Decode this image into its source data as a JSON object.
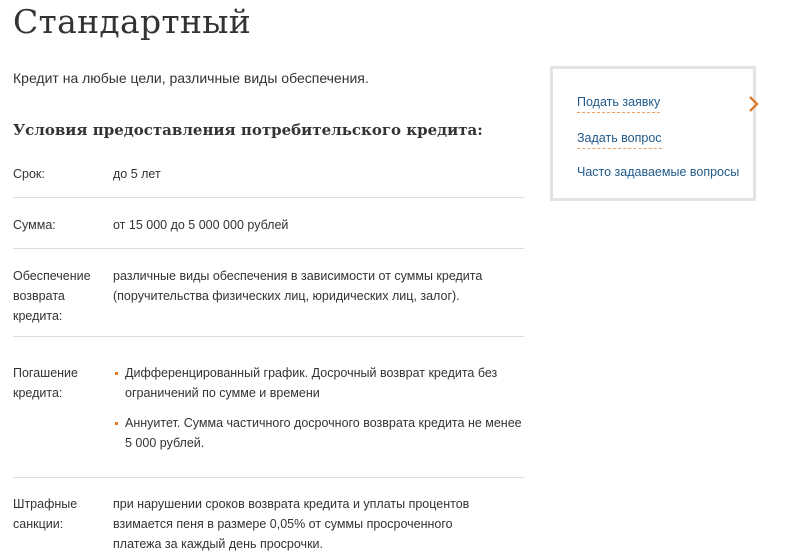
{
  "page": {
    "title": "Стандартный",
    "intro": "Кредит на любые цели, различные виды обеспечения.",
    "subtitle": "Условия предоставления потребительского кредита:"
  },
  "conditions": {
    "term": {
      "label": "Срок:",
      "value": "до 5 лет"
    },
    "amount": {
      "label": "Сумма:",
      "value": "от 15 000 до 5 000 000 рублей"
    },
    "collateral": {
      "label": "Обеспечение возврата кредита:",
      "value": "различные виды обеспечения в зависимости от суммы кредита (поручительства физических лиц, юридических лиц, залог)."
    },
    "repayment": {
      "label": "Погашение кредита:",
      "items": [
        "Дифференцированный график. Досрочный возврат кредита без ограничений по сумме и времени",
        "Аннуитет. Сумма частичного досрочного возврата кредита не менее 5 000 рублей."
      ]
    },
    "penalties": {
      "label": "Штрафные санкции:",
      "value": "при нарушении сроков возврата кредита и уплаты процентов взимается пеня в размере 0,05% от суммы просроченного платежа за каждый день просрочки."
    }
  },
  "sidebar": {
    "apply_label": "Подать заявку",
    "ask_label": "Задать вопрос",
    "faq_label": "Часто задаваемые вопросы",
    "apply_icon": "chevron-right-icon",
    "accent_color": "#e07b2a",
    "link_color": "#1f5a8a"
  }
}
